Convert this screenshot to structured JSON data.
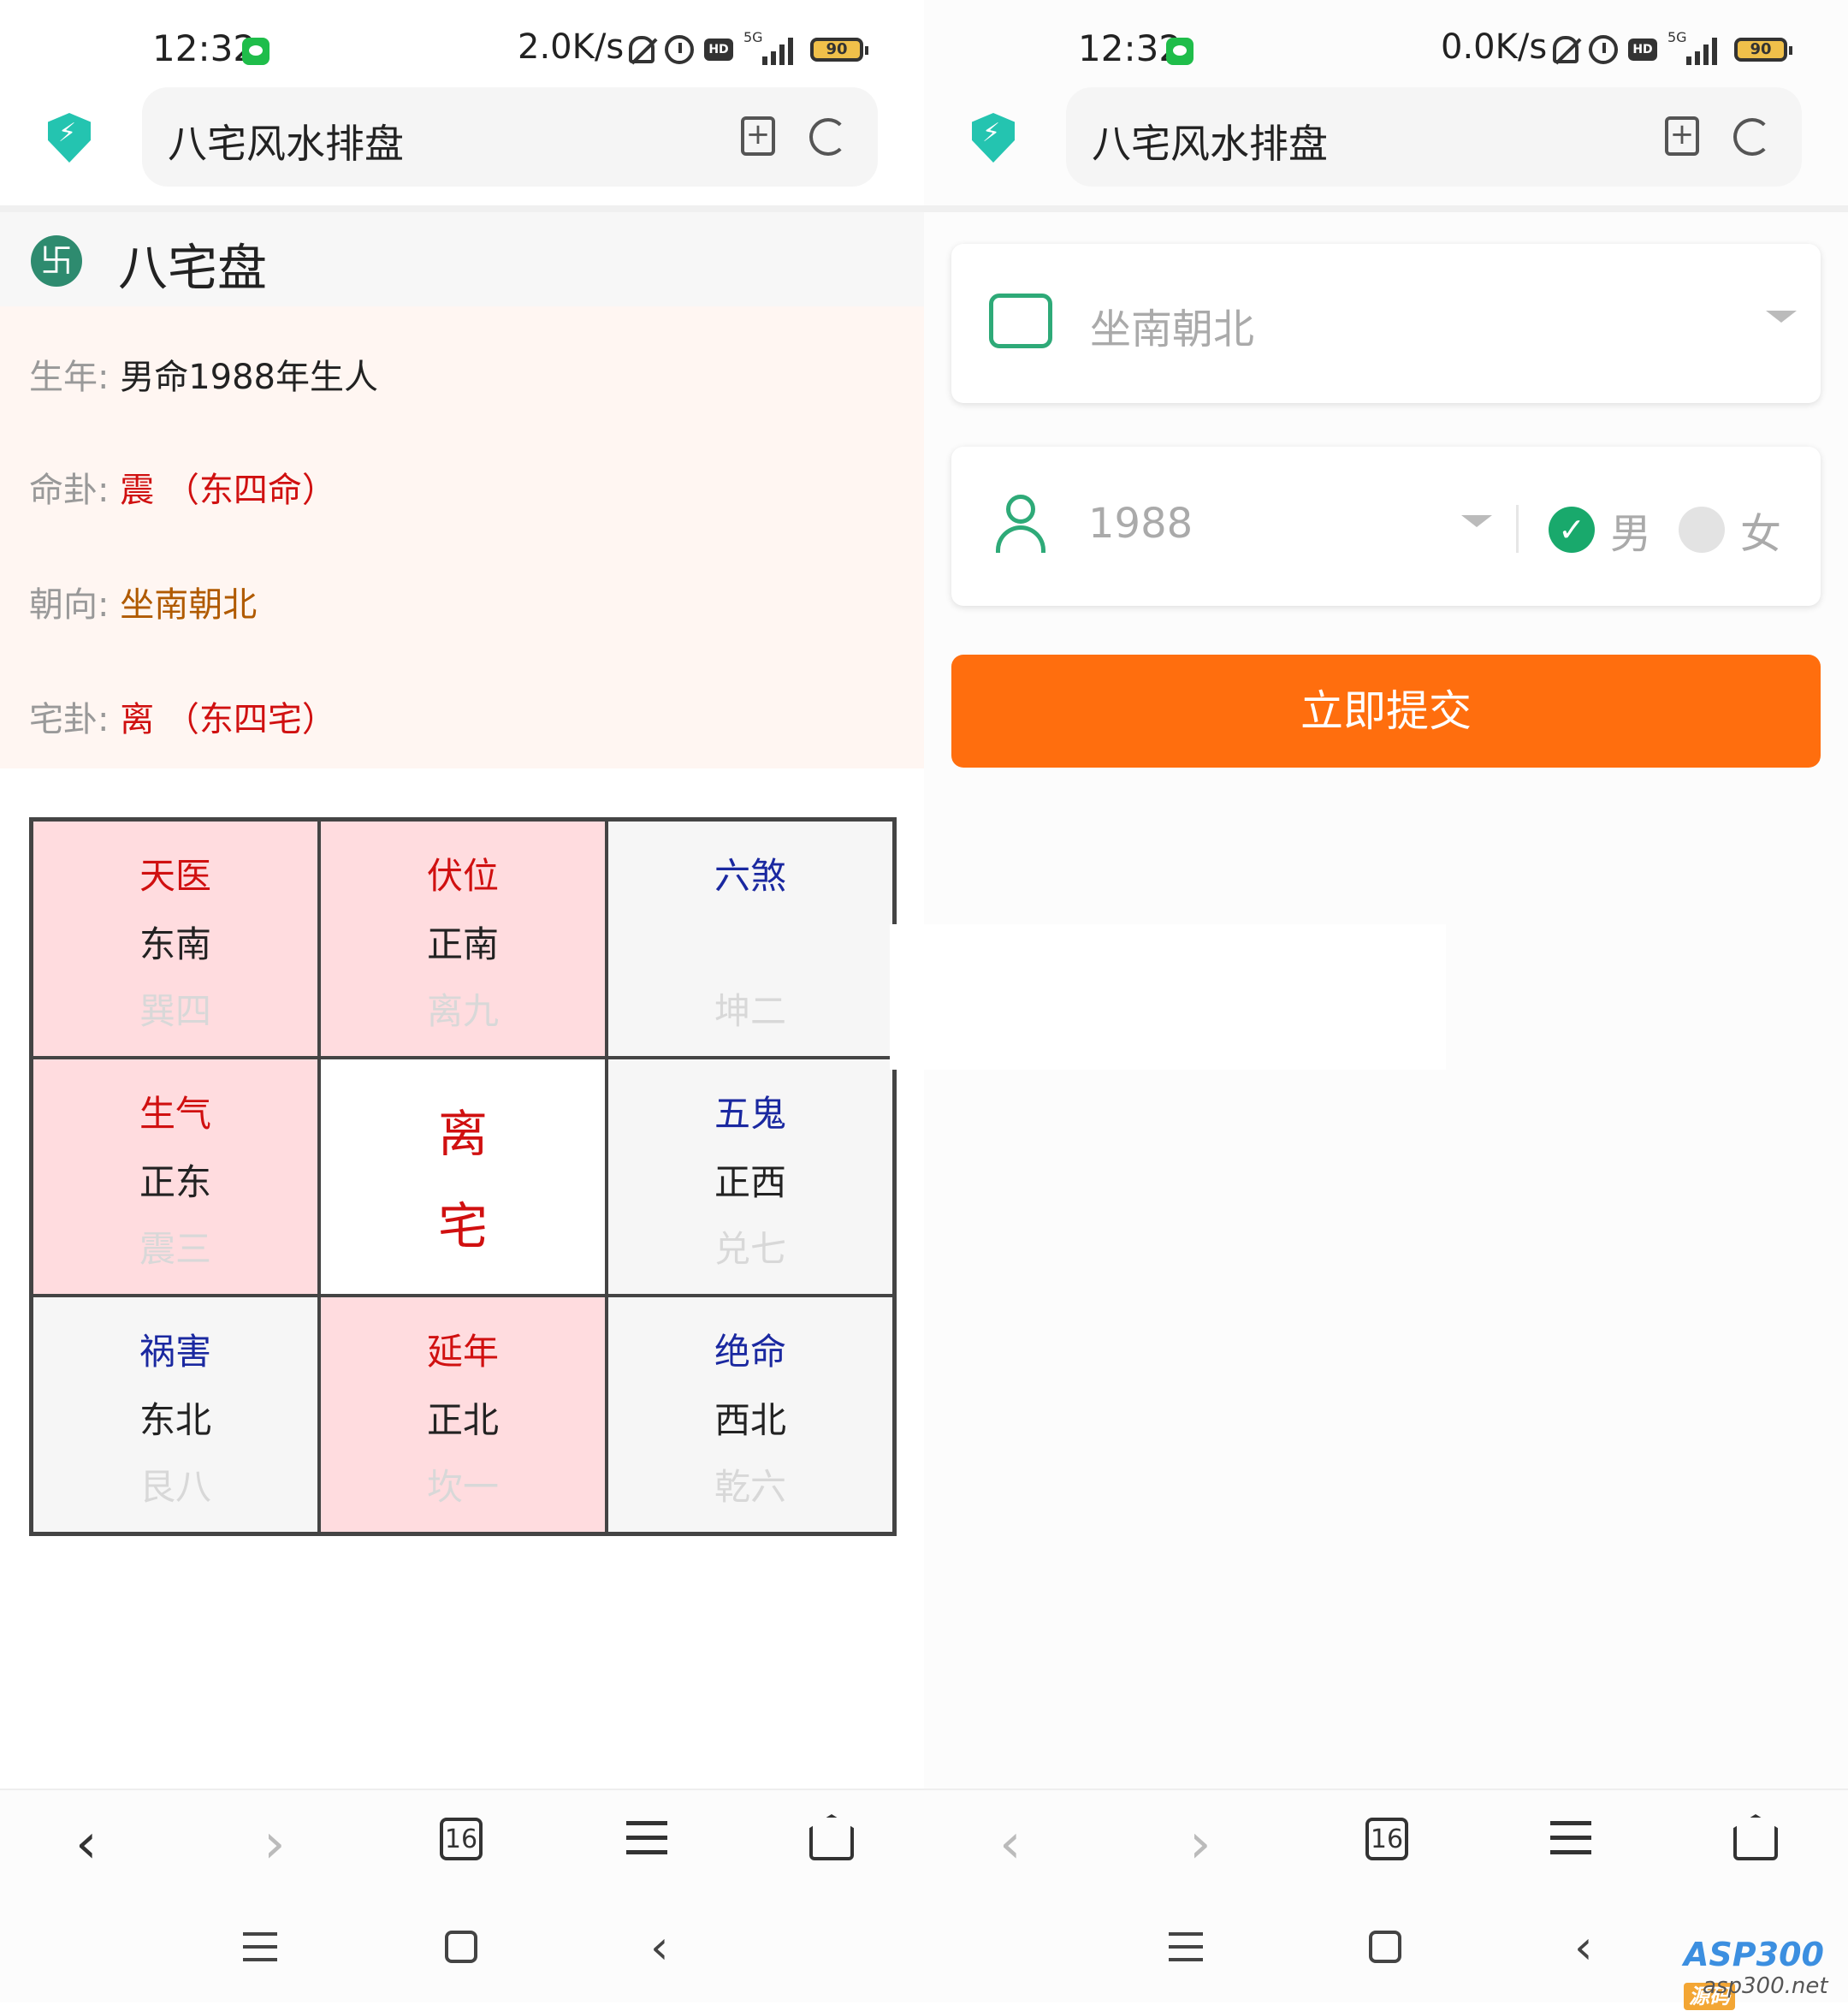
{
  "left": {
    "status": {
      "time": "12:32",
      "speed": "2.0K/s",
      "battery": "90",
      "network": "5G"
    },
    "address_bar": {
      "title": "八宅风水排盘"
    },
    "panel_title": "八宅盘",
    "info": [
      {
        "label": "生年:",
        "value": "男命1988年生人"
      },
      {
        "label": "命卦:",
        "value": "震 （东四命）"
      },
      {
        "label": "朝向:",
        "value": "坐南朝北"
      },
      {
        "label": "宅卦:",
        "value": "离 （东四宅）"
      }
    ],
    "grid": [
      {
        "star": "天医",
        "direction": "东南",
        "trigram": "巽四",
        "type": "good"
      },
      {
        "star": "伏位",
        "direction": "正南",
        "trigram": "离九",
        "type": "good"
      },
      {
        "star": "六煞",
        "direction": "",
        "trigram": "坤二",
        "type": "bad"
      },
      {
        "star": "生气",
        "direction": "正东",
        "trigram": "震三",
        "type": "good"
      },
      {
        "center1": "离",
        "center2": "宅"
      },
      {
        "star": "五鬼",
        "direction": "正西",
        "trigram": "兑七",
        "type": "bad"
      },
      {
        "star": "祸害",
        "direction": "东北",
        "trigram": "艮八",
        "type": "bad"
      },
      {
        "star": "延年",
        "direction": "正北",
        "trigram": "坎一",
        "type": "good"
      },
      {
        "star": "绝命",
        "direction": "西北",
        "trigram": "乾六",
        "type": "bad"
      }
    ],
    "browser_nav": {
      "tabs_count": "16"
    }
  },
  "right": {
    "status": {
      "time": "12:32",
      "speed": "0.0K/s",
      "battery": "90",
      "network": "5G"
    },
    "address_bar": {
      "title": "八宅风水排盘"
    },
    "orientation_select": {
      "value": "坐南朝北"
    },
    "year_select": {
      "value": "1988"
    },
    "gender": {
      "male": "男",
      "female": "女",
      "selected": "男"
    },
    "submit_label": "立即提交",
    "browser_nav": {
      "tabs_count": "16"
    }
  },
  "watermark": {
    "brand": "ASP300",
    "tag": "源码",
    "url": "asp300.net"
  },
  "colors": {
    "good_bg": "#ffdcdf",
    "bad_bg": "#f6f6f6",
    "accent": "#ff6e0e",
    "green": "#19a96c"
  }
}
